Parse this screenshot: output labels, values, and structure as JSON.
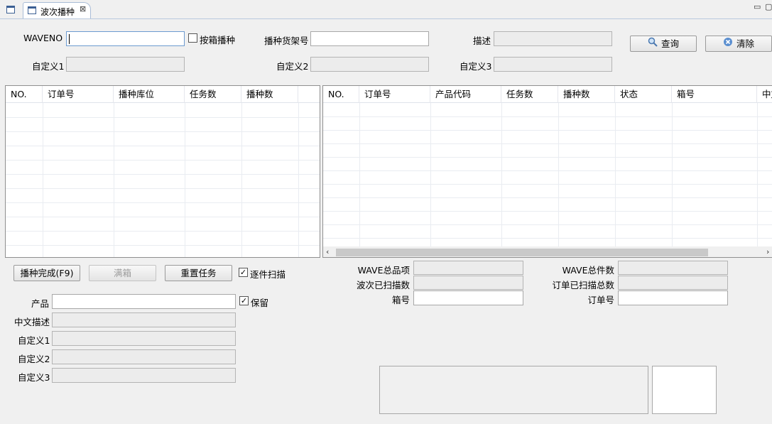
{
  "tab": {
    "title": "波次播种",
    "close": "⊠"
  },
  "window": {
    "minimize": "▭",
    "maximize": "▢"
  },
  "header": {
    "waveno_label": "WAVENO",
    "waveno_value": "",
    "by_box_label": "按箱播种",
    "shelf_label": "播种货架号",
    "shelf_value": "",
    "desc_label": "描述",
    "desc_value": "",
    "custom1_label": "自定义1",
    "custom2_label": "自定义2",
    "custom3_label": "自定义3",
    "query_button": "查询",
    "clear_button": "清除"
  },
  "left_table": {
    "columns": [
      "NO.",
      "订单号",
      "播种库位",
      "任务数",
      "播种数"
    ],
    "rows": []
  },
  "right_table": {
    "columns": [
      "NO.",
      "订单号",
      "产品代码",
      "任务数",
      "播种数",
      "状态",
      "箱号",
      "中文"
    ],
    "rows": []
  },
  "actions": {
    "complete_button": "播种完成(F9)",
    "full_box_button": "满箱",
    "reset_button": "重置任务",
    "scan_each_label": "逐件扫描",
    "scan_each_checked": true
  },
  "product_form": {
    "product_label": "产品",
    "product_value": "",
    "keep_label": "保留",
    "keep_checked": true,
    "cn_desc_label": "中文描述",
    "custom1_label": "自定义1",
    "custom2_label": "自定义2",
    "custom3_label": "自定义3"
  },
  "stats": {
    "wave_items_label": "WAVE总品项",
    "wave_items_value": "",
    "wave_scanned_label": "波次已扫描数",
    "wave_scanned_value": "",
    "box_no_label": "箱号",
    "box_no_value": "",
    "wave_total_label": "WAVE总件数",
    "wave_total_value": "",
    "order_scanned_label": "订单已扫描总数",
    "order_scanned_value": "",
    "order_no_label": "订单号",
    "order_no_value": ""
  },
  "colors": {
    "accent": "#6c9ad0",
    "border": "#a8a8a8",
    "readonly": "#ececec"
  }
}
